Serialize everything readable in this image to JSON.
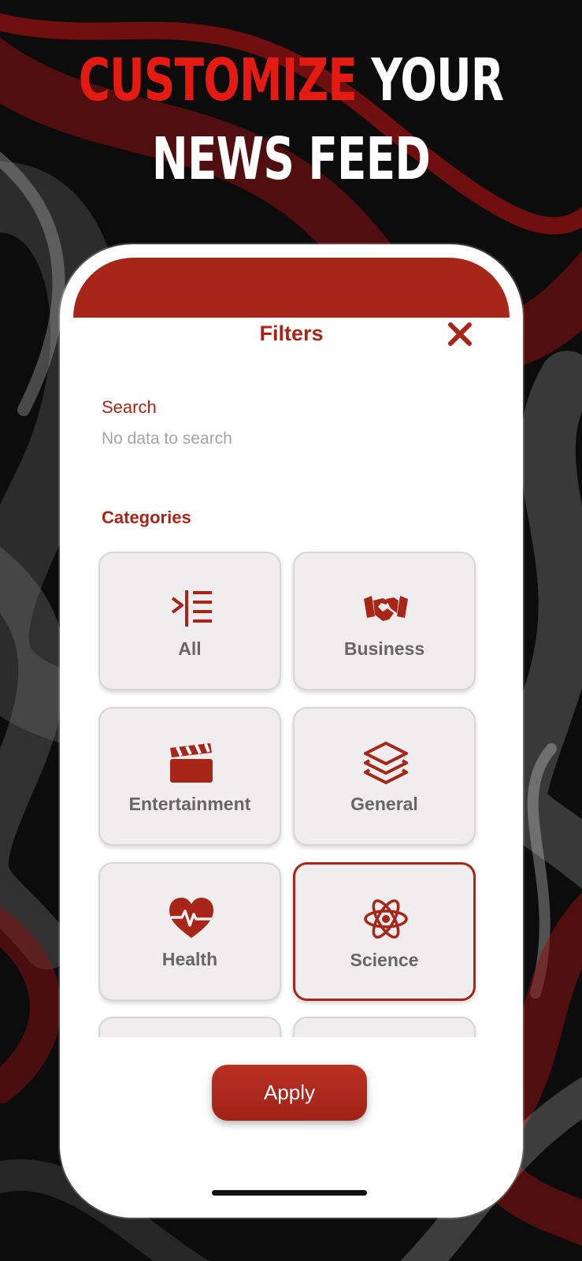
{
  "headline": {
    "accent": "CUSTOMIZE",
    "line1_rest": " YOUR",
    "line2": "NEWS FEED"
  },
  "filters": {
    "title": "Filters",
    "close_icon": "close-icon",
    "search": {
      "label": "Search",
      "placeholder": "No data to search",
      "value": ""
    },
    "categories": {
      "label": "Categories",
      "items": [
        {
          "label": "All",
          "icon": "list-indent-icon",
          "selected": false
        },
        {
          "label": "Business",
          "icon": "handshake-icon",
          "selected": false
        },
        {
          "label": "Entertainment",
          "icon": "clapperboard-icon",
          "selected": false
        },
        {
          "label": "General",
          "icon": "layers-icon",
          "selected": false
        },
        {
          "label": "Health",
          "icon": "heart-pulse-icon",
          "selected": false
        },
        {
          "label": "Science",
          "icon": "atom-icon",
          "selected": true
        }
      ]
    },
    "apply_label": "Apply"
  },
  "colors": {
    "accent": "#a82618",
    "headline_accent": "#e51b13",
    "tile_background": "#efedee",
    "tile_text": "#666666"
  }
}
